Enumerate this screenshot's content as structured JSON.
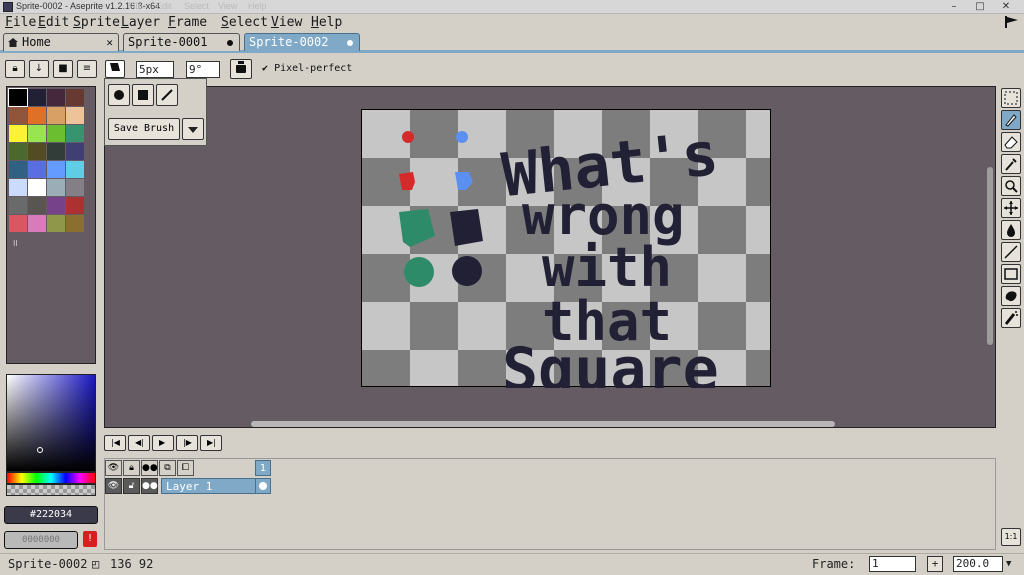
{
  "window": {
    "title": "Sprite-0002 - Aseprite v1.2.16.3-x64",
    "faint_menu": [
      "File",
      "Edit",
      "Select",
      "View",
      "Help"
    ]
  },
  "window_controls": {
    "minimize": "–",
    "maximize": "□",
    "close": "✕"
  },
  "menu": [
    "File",
    "Edit",
    "Sprite",
    "Layer",
    "Frame",
    "Select",
    "View",
    "Help"
  ],
  "tabs": [
    {
      "label": "Home",
      "closable": true
    },
    {
      "label": "Sprite-0001",
      "modified": true
    },
    {
      "label": "Sprite-0002",
      "modified": true,
      "active": true
    }
  ],
  "context_bar": {
    "brush_size": "5px",
    "brush_angle": "9°",
    "pixel_perfect": "Pixel-perfect"
  },
  "brush_popup": {
    "save_label": "Save Brush"
  },
  "palette": {
    "colors": [
      "#000000",
      "#222034",
      "#45283c",
      "#663931",
      "#8f563b",
      "#df7126",
      "#d9a066",
      "#eec39a",
      "#fbf236",
      "#99e550",
      "#6abe30",
      "#37946e",
      "#4b692f",
      "#524b24",
      "#323c39",
      "#3f3f74",
      "#306082",
      "#5b6ee1",
      "#639bff",
      "#5fcde4",
      "#cbdbfc",
      "#ffffff",
      "#9badb7",
      "#847e87",
      "#696a6a",
      "#595652",
      "#76428a",
      "#ac3232",
      "#d95763",
      "#d77bba",
      "#8f974a",
      "#8a6f30"
    ],
    "overflow_marker": "II"
  },
  "colors": {
    "foreground_hex": "#222034",
    "background_label": "0000000"
  },
  "sprite": {
    "text_lines": [
      "What's",
      "wrong",
      "with",
      "that",
      "Square"
    ],
    "ink": "#222034",
    "red": "#d42a2a",
    "blue": "#5b8ff0",
    "green": "#2e8b6a"
  },
  "timeline": {
    "frame_header": "1",
    "layer_name": "Layer 1"
  },
  "status": {
    "sprite_name": "Sprite-0002",
    "cursor": "136  92",
    "frame_label": "Frame:",
    "frame_value": "1",
    "add_frame": "+",
    "zoom": "200.0"
  }
}
